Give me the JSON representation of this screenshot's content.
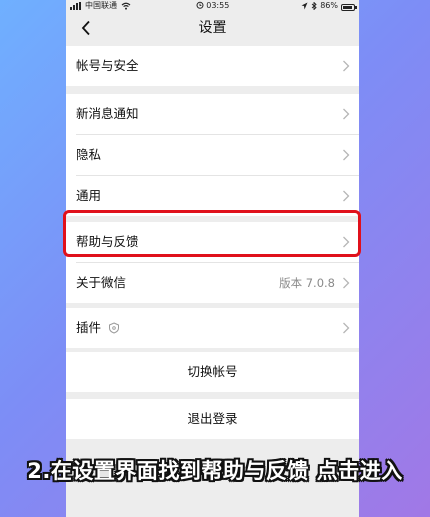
{
  "status_bar": {
    "carrier": "中国联通",
    "time": "03:55",
    "battery": "86%",
    "battery_level": 0.86
  },
  "nav": {
    "title": "设置",
    "back_icon": "chevron-left-icon"
  },
  "settings": {
    "account_security": "帐号与安全",
    "new_message_notify": "新消息通知",
    "privacy": "隐私",
    "general": "通用",
    "help_feedback": "帮助与反馈",
    "about": "关于微信",
    "about_version": "版本 7.0.8",
    "plugins": "插件"
  },
  "actions": {
    "switch_account": "切换帐号",
    "logout": "退出登录"
  },
  "annotation": {
    "caption": "2.在设置界面找到帮助与反馈 点击进入",
    "highlight_color": "#e0101b"
  }
}
